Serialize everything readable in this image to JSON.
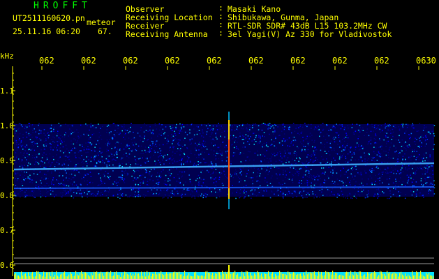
{
  "header": {
    "logo": "HROFFT",
    "filename": "UT2511160620.pn",
    "event": "meteor",
    "datetime": "25.11.16 06:20",
    "count": "67."
  },
  "info": {
    "labels": [
      "Observer",
      "Receiving Location",
      "Receiver",
      "Receiving Antenna"
    ],
    "separator": ":",
    "values": [
      "Masaki Kano",
      "Shibukawa, Gunma, Japan",
      "RTL-SDR SDR# 43dB L15 103.2MHz CW",
      "3el Yagi(V) Az 330 for Vladivostok"
    ]
  },
  "axis": {
    "unit": "kHz",
    "time_ticks": [
      "062",
      "062",
      "062",
      "062",
      "062",
      "062",
      "062",
      "062",
      "062",
      "0630"
    ],
    "freq_labels": [
      "1.1",
      "1.0",
      "0.9",
      "0.8",
      "0.7",
      "0.6"
    ]
  },
  "colors": {
    "text": "#ffff00",
    "logo": "#00ff00",
    "background": "#000000",
    "spectrum_low": "#00008b",
    "spectrum_mid": "#00bfff",
    "spectrum_high": "#ffff00"
  }
}
